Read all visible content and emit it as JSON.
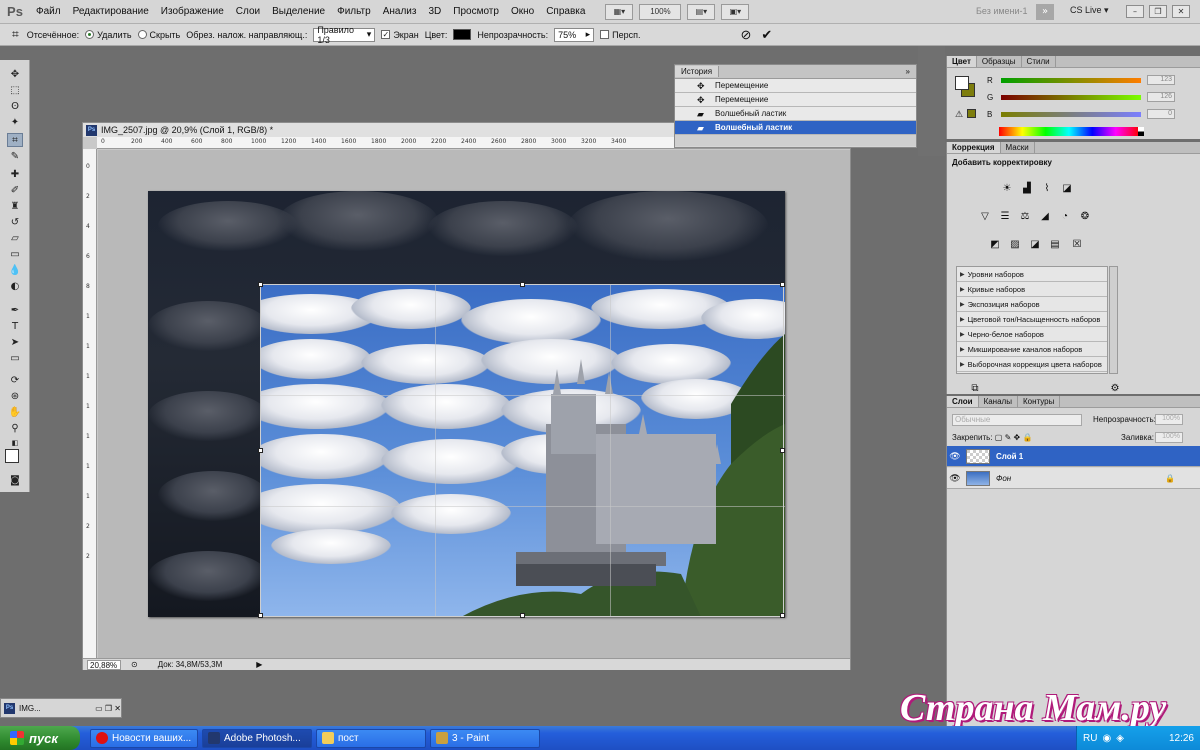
{
  "app": {
    "logo": "Ps",
    "menu": [
      "Файл",
      "Редактирование",
      "Изображение",
      "Слои",
      "Выделение",
      "Фильтр",
      "Анализ",
      "3D",
      "Просмотр",
      "Окно",
      "Справка"
    ],
    "zoom": "100%",
    "workspace": "Без имени-1",
    "cs_live": "CS Live"
  },
  "options_bar": {
    "crop_label": "Отсечённое:",
    "delete_label": "Удалить",
    "hide_label": "Скрыть",
    "overlay_label": "Обрез. налож. направляющ.:",
    "overlay_value": "Правило 1/3",
    "shield_label": "Экран",
    "color_label": "Цвет:",
    "opacity_label": "Непрозрачность:",
    "opacity_value": "75%",
    "perspective_label": "Персп."
  },
  "document": {
    "title": "IMG_2507.jpg @ 20,9% (Слой 1, RGB/8) *",
    "ruler_h": [
      "0",
      "200",
      "400",
      "600",
      "800",
      "1000",
      "1200",
      "1400",
      "1600",
      "1800",
      "2000",
      "2200",
      "2400",
      "2600",
      "2800",
      "3000",
      "3200",
      "3400"
    ],
    "ruler_v": [
      "0",
      "2",
      "4",
      "6",
      "8",
      "1",
      "1",
      "1",
      "1",
      "1",
      "1",
      "1",
      "2",
      "2"
    ],
    "status_zoom": "20,88%",
    "doc_size": "Док: 34,8M/53,3M"
  },
  "history": {
    "tab": "История",
    "items": [
      "Перемещение",
      "Перемещение",
      "Волшебный ластик",
      "Волшебный ластик"
    ],
    "active_index": 3
  },
  "color_panel": {
    "tabs": [
      "Цвет",
      "Образцы",
      "Стили"
    ],
    "channels": [
      {
        "label": "R",
        "value": "123"
      },
      {
        "label": "G",
        "value": "126"
      },
      {
        "label": "B",
        "value": "0"
      }
    ]
  },
  "adjustments": {
    "tabs": [
      "Коррекция",
      "Маски"
    ],
    "title": "Добавить корректировку",
    "presets": [
      "Уровни наборов",
      "Кривые наборов",
      "Экспозиция наборов",
      "Цветовой тон/Насыщенность наборов",
      "Черно-белое наборов",
      "Микширование каналов наборов",
      "Выборочная коррекция цвета наборов"
    ]
  },
  "layers": {
    "tabs": [
      "Слои",
      "Каналы",
      "Контуры"
    ],
    "blend_mode": "Обычные",
    "opacity_label": "Непрозрачность:",
    "opacity_value": "100%",
    "lock_label": "Закрепить:",
    "fill_label": "Заливка:",
    "fill_value": "100%",
    "items": [
      {
        "name": "Слой 1",
        "active": true
      },
      {
        "name": "Фон",
        "active": false
      }
    ]
  },
  "taskbar": {
    "start": "пуск",
    "tasks": [
      "Новости ваших...",
      "Adobe Photosh...",
      "пост",
      "3 - Paint"
    ],
    "lang": "RU",
    "clock": "12:26"
  },
  "mini_window": "IMG...",
  "watermark": "Страна Мам.ру",
  "colors": {
    "foreground": "#ffffff",
    "background": "#7d7d0d",
    "selection": "#2f63c4"
  }
}
